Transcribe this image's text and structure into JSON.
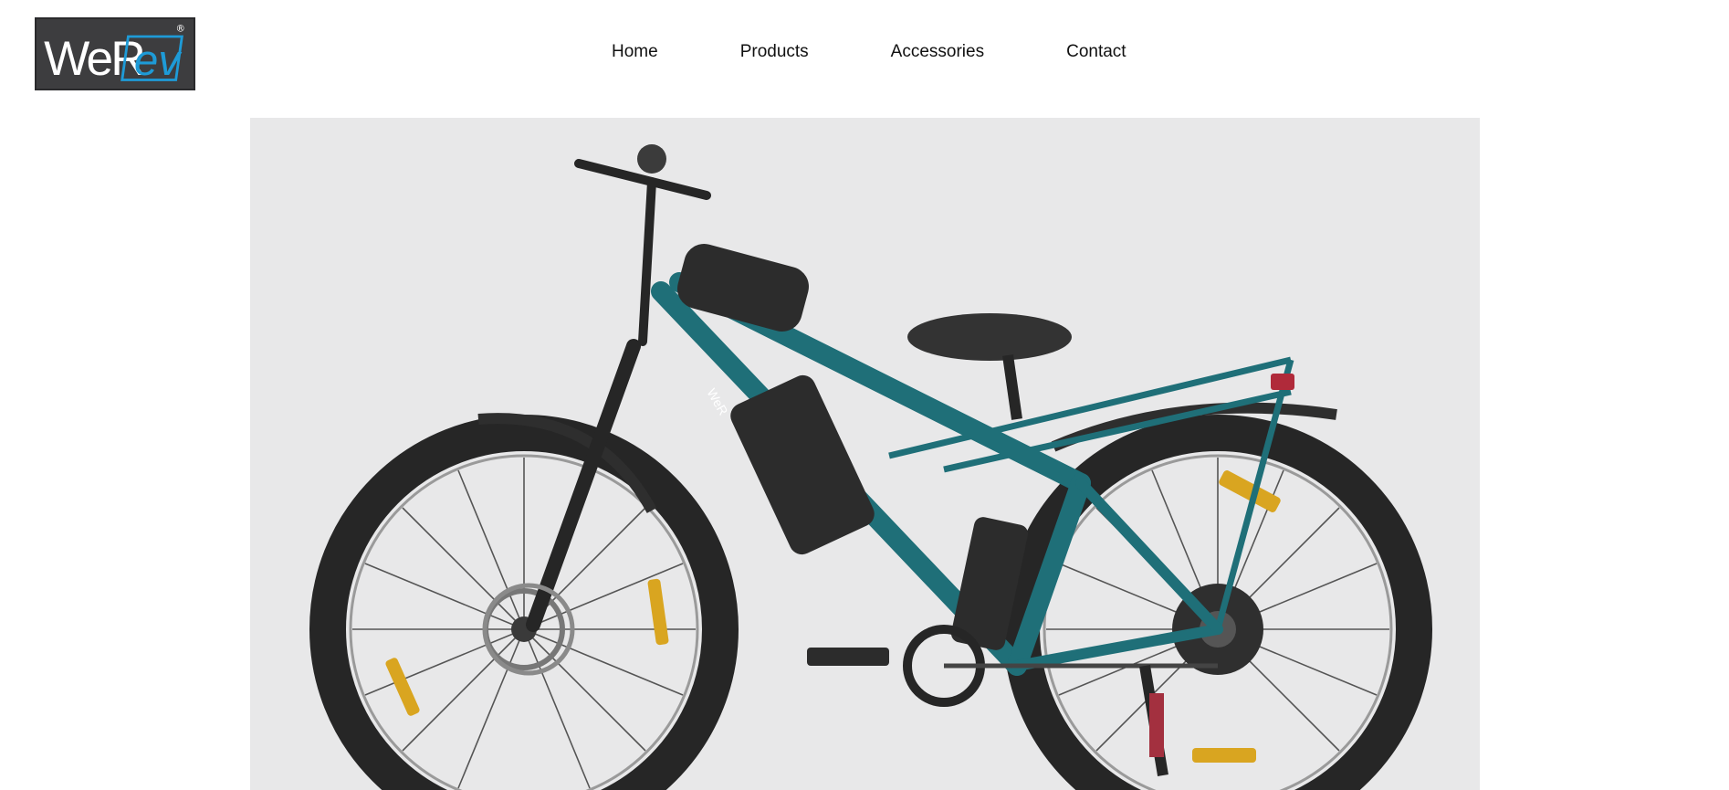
{
  "brand": {
    "logo_text_a": "WeR",
    "logo_text_b": "ev",
    "registered_mark": "®",
    "logo_bg": "#3d3d3f",
    "logo_accent": "#1e9bd7"
  },
  "nav": {
    "items": [
      {
        "label": "Home"
      },
      {
        "label": "Products"
      },
      {
        "label": "Accessories"
      },
      {
        "label": "Contact"
      }
    ]
  },
  "hero": {
    "image_subject": "teal electric bicycle on light grey background",
    "frame_label": "WeR",
    "colors": {
      "background": "#e8e8e9",
      "frame": "#1f6f78",
      "tyre": "#2a2a2a",
      "reflector": "#d9a520"
    }
  }
}
